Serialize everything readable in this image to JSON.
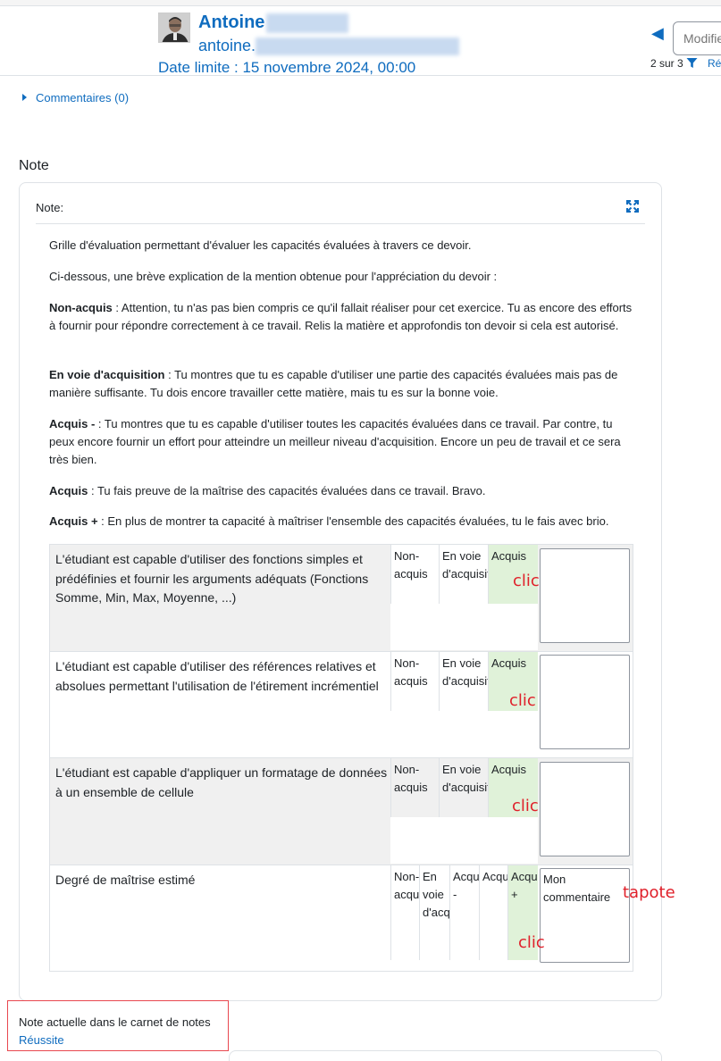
{
  "header": {
    "first_name": "Antoine",
    "email_prefix": "antoine.",
    "due_date": "Date limite : 15 novembre 2024, 00:00",
    "user_select_placeholder": "Modifier",
    "counter": "2 sur 3",
    "reset_label": "Ré"
  },
  "comments_link": "Commentaires (0)",
  "grade_section": {
    "title": "Note",
    "card_label": "Note:",
    "description": [
      {
        "bold": "",
        "text": "Grille d'évaluation permettant d'évaluer les capacités évaluées à travers ce devoir."
      },
      {
        "bold": "",
        "text": "Ci-dessous, une brève explication de la mention obtenue pour l'appréciation du devoir :"
      },
      {
        "bold": "Non-acquis",
        "text": " : Attention, tu n'as pas bien compris ce qu'il fallait réaliser pour cet exercice. Tu as encore des efforts à fournir pour répondre correctement à ce travail. Relis la matière et approfondis ton devoir si cela est autorisé."
      },
      {
        "bold": "En voie d'acquisition",
        "text": " : Tu montres que tu es capable d'utiliser une partie des capacités évaluées mais pas de manière suffisante.  Tu dois encore travailler cette matière, mais tu es sur la bonne voie."
      },
      {
        "bold": "Acquis -",
        "text": " : Tu montres que tu es capable d'utiliser toutes les capacités évaluées dans ce travail.  Par contre, tu peux encore fournir un effort pour atteindre un meilleur niveau d'acquisition.  Encore un peu de travail et ce sera très bien."
      },
      {
        "bold": "Acquis",
        "text": " : Tu fais preuve de la maîtrise des capacités évaluées dans ce travail. Bravo."
      },
      {
        "bold": "Acquis +",
        "text": " : En plus de montrer ta capacité à maîtriser l'ensemble des capacités évaluées, tu le fais avec brio."
      }
    ]
  },
  "rubric": {
    "criteria": [
      {
        "description": "L'étudiant est capable d'utiliser des fonctions simples et prédéfinies et fournir les arguments adéquats (Fonctions Somme, Min, Max, Moyenne, ...)",
        "levels": [
          "Non-acquis",
          "En voie d'acquisition",
          "Acquis"
        ],
        "selected": 2,
        "remark": ""
      },
      {
        "description": "L'étudiant est capable d'utiliser des références relatives et absolues permettant l'utilisation de l'étirement incrémentiel",
        "levels": [
          "Non-acquis",
          "En voie d'acquisition",
          "Acquis"
        ],
        "selected": 2,
        "remark": ""
      },
      {
        "description": "L'étudiant est capable d'appliquer un formatage de données à un ensemble de cellule",
        "levels": [
          "Non-acquis",
          "En voie d'acquisition",
          "Acquis"
        ],
        "selected": 2,
        "remark": ""
      },
      {
        "description": "Degré de maîtrise estimé",
        "levels": [
          "Non-acquis",
          "En voie d'acquisition",
          "Acquis -",
          "Acquis",
          "Acquis +"
        ],
        "selected": 4,
        "remark": "Mon commentaire"
      }
    ]
  },
  "annotations": {
    "click": "clic",
    "tap": "tapote"
  },
  "current_grade": {
    "label": "Note actuelle dans le carnet de notes",
    "value": "Réussite"
  },
  "colors": {
    "link": "#0f6cbf",
    "selected_level": "#e0f2d9",
    "annotation": "#e0202a",
    "highlight_border": "#e8474f"
  },
  "icons": [
    "user-avatar-icon",
    "previous-arrow-icon",
    "filter-icon",
    "caret-right-icon",
    "expand-icon",
    "resize-grip-icon"
  ]
}
